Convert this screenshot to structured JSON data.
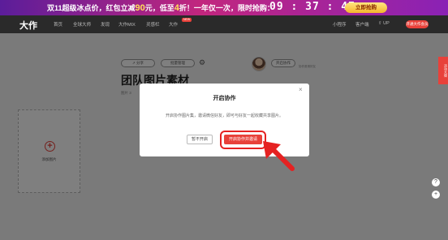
{
  "promo": {
    "text_a": "双11超级冰点价，红包立减",
    "num_a": "90",
    "text_b": "元，低至",
    "num_b": "4",
    "text_c": "折！一年仅一次，限时抢购：",
    "countdown": "09 : 37 : 47",
    "cta": "立即抢购"
  },
  "nav": {
    "logo": "大作",
    "items": [
      "首页",
      "全球大师",
      "发现",
      "大作MIX",
      "灵感栏",
      "大作"
    ],
    "new_badge": "NEW",
    "right": [
      "小程序",
      "客户端",
      "UP"
    ],
    "vip": "开通大作会员"
  },
  "page": {
    "share_button": "分享",
    "batch_button": "批量管理",
    "settings_icon": "gear-icon",
    "collab_button": "开启协作",
    "tip": "协作邀请好友",
    "title": "团队图片素材",
    "crumb": "图片 3",
    "upload_label": "添加图片",
    "side_tab": "活动大使"
  },
  "modal": {
    "title": "开启协作",
    "close": "×",
    "body": "开启协作图片集，邀请微信好友，即可与好友一起收藏共享图片。",
    "cancel": "暂不开启",
    "confirm": "开启协作并邀请"
  },
  "colors": {
    "accent": "#e8413a",
    "highlight": "#e52222",
    "nav_bg": "#2a2a2a"
  }
}
